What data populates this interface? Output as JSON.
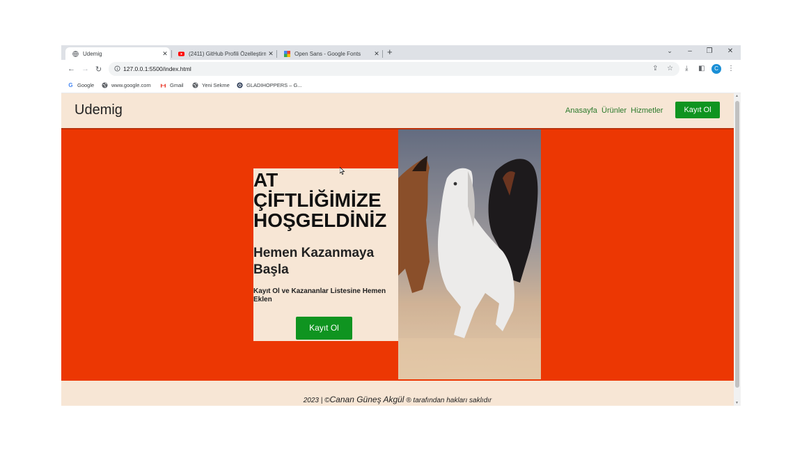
{
  "browser": {
    "tabs": [
      {
        "title": "Udemig",
        "active": true,
        "icon": "globe-icon"
      },
      {
        "title": "(2411) GitHub Profili Özelleştirme",
        "active": false,
        "icon": "youtube-icon"
      },
      {
        "title": "Open Sans - Google Fonts",
        "active": false,
        "icon": "google-fonts-icon"
      }
    ],
    "url": "127.0.0.1:5500/index.html",
    "bookmarks": [
      {
        "label": "Google",
        "icon": "google-icon"
      },
      {
        "label": "www.google.com",
        "icon": "globe-icon"
      },
      {
        "label": "Gmail",
        "icon": "gmail-icon"
      },
      {
        "label": "Yeni Sekme",
        "icon": "globe-icon"
      },
      {
        "label": "GLADIHOPPERS – G...",
        "icon": "gladihoppers-icon"
      }
    ],
    "profile_initial": "C"
  },
  "site": {
    "brand": "Udemig",
    "nav": [
      "Anasayfa",
      "Ürünler",
      "Hizmetler"
    ],
    "nav_button": "Kayıt Ol",
    "hero": {
      "title": "AT ÇİFTLİĞİMİZE HOŞGELDİNİZ",
      "subtitle": "Hemen Kazanmaya Başla",
      "tagline": "Kayıt Ol ve Kazananlar Listesine Hemen Eklen",
      "button": "Kayıt Ol"
    },
    "footer": {
      "prefix": "2023 | ©",
      "name": "Canan Güneş Akgül",
      "suffix": " ® tarafından hakları saklıdır"
    }
  },
  "colors": {
    "hero_bg": "#ec3703",
    "cream": "#f7e6d5",
    "green": "#0f9420",
    "nav_link": "#2c7a2c"
  }
}
